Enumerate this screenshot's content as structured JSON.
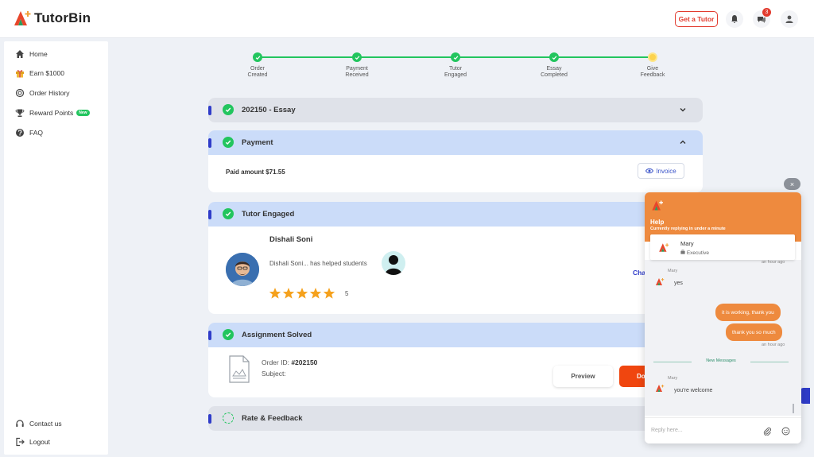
{
  "brand": {
    "name": "TutorBin"
  },
  "header": {
    "get_tutor_label": "Get a Tutor",
    "notifications_icon": "bell-icon",
    "messages_icon": "chat-bubble-icon",
    "messages_badge": "3",
    "profile_icon": "user-icon"
  },
  "sidebar": {
    "items": [
      {
        "label": "Home",
        "icon": "home-icon"
      },
      {
        "label": "Earn $1000",
        "icon": "gift-icon"
      },
      {
        "label": "Order History",
        "icon": "history-icon"
      },
      {
        "label": "Reward Points",
        "icon": "trophy-icon",
        "badge": "New"
      },
      {
        "label": "FAQ",
        "icon": "question-icon"
      }
    ],
    "bottom": [
      {
        "label": "Contact us",
        "icon": "headset-icon"
      },
      {
        "label": "Logout",
        "icon": "logout-icon"
      }
    ]
  },
  "progress": {
    "steps": [
      {
        "label": "Order\nCreated",
        "done": true
      },
      {
        "label": "Payment\nReceived",
        "done": true
      },
      {
        "label": "Tutor\nEngaged",
        "done": true
      },
      {
        "label": "Essay\nCompleted",
        "done": true
      },
      {
        "label": "Give\nFeedback",
        "done": false
      }
    ]
  },
  "sections": {
    "essay": {
      "title": "202150 - Essay"
    },
    "payment": {
      "title": "Payment",
      "paid_amount": "Paid amount $71.55",
      "invoice_label": "Invoice"
    },
    "tutor": {
      "title": "Tutor Engaged",
      "name": "Dishali Soni",
      "helped_text": "Dishali Soni... has helped  students",
      "rating": "5",
      "stars": 5,
      "chat_link": "Cha"
    },
    "assignment": {
      "title": "Assignment Solved",
      "order_id_label": "Order ID: ",
      "order_id": "#202150",
      "subject_label": "Subject:",
      "preview_label": "Preview",
      "download_label": "Do"
    },
    "rate": {
      "title": "Rate & Feedback"
    }
  },
  "chat": {
    "close": "×",
    "title": "Help",
    "subtitle": "Currently replying in under a minute",
    "agent_name": "Mary",
    "agent_role": "Executive",
    "messages": {
      "time_top": "an hour ago",
      "m1_sender": "Mary",
      "m1_text": "yes",
      "out1": "it is working, thank you",
      "out2": "thank you so much",
      "time_out": "an hour ago",
      "new_messages": "New Messages",
      "m2_sender": "Mary",
      "m2_text": "you're welcome"
    },
    "input_placeholder": "Reply here..."
  },
  "colors": {
    "accent": "#ee8a3e",
    "success": "#22c55e",
    "primary": "#2f3cc9",
    "danger": "#e23b2e"
  }
}
